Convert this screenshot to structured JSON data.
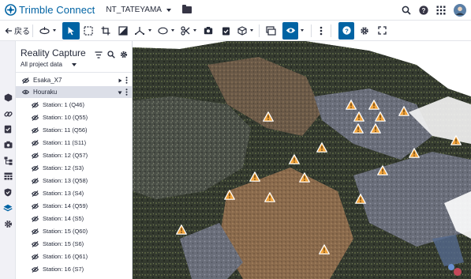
{
  "app": {
    "brand": "Trimble Connect",
    "project_name": "NT_TATEYAMA"
  },
  "toolbar": {
    "back_label": "戻る"
  },
  "panel": {
    "title": "Reality Capture",
    "filter_label": "All project data",
    "groups": [
      {
        "label": "Esaka_X7",
        "visible": false
      },
      {
        "label": "Houraku",
        "visible": true,
        "selected": true
      }
    ],
    "stations": [
      "Station: 1 (Q46)",
      "Station: 10 (Q55)",
      "Station: 11 (Q56)",
      "Station: 11 (S11)",
      "Station: 12 (Q57)",
      "Station: 12 (S3)",
      "Station: 13 (Q58)",
      "Station: 13 (S4)",
      "Station: 14 (Q59)",
      "Station: 14 (S5)",
      "Station: 15 (Q60)",
      "Station: 15 (S6)",
      "Station: 16 (Q61)",
      "Station: 16 (S7)"
    ]
  },
  "colors": {
    "brand_blue": "#0063a3",
    "marker_orange": "#f2a33a",
    "selected_row": "#dcdfe8"
  },
  "icons": {
    "top_right": [
      "search-icon",
      "help-icon",
      "apps-grid-icon",
      "user-avatar-icon"
    ],
    "left_rail": [
      "cube-icon",
      "link-icon",
      "clipboard-check-icon",
      "camera-icon",
      "hierarchy-icon",
      "table-icon",
      "shield-icon",
      "layers-icon",
      "settings-gear-icon"
    ]
  }
}
